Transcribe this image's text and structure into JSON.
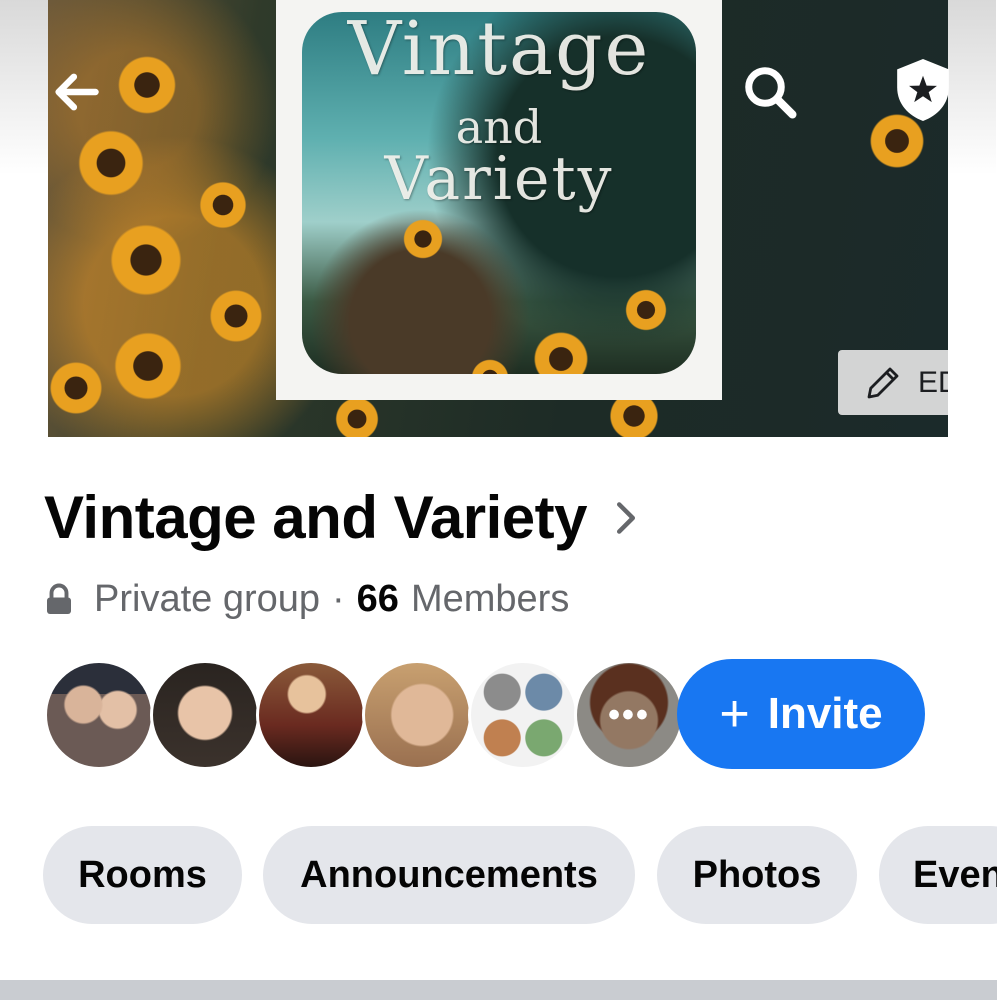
{
  "cover": {
    "title_line1": "Vintage",
    "title_line2": "and",
    "title_line3": "Variety",
    "edit_label": "EDIT"
  },
  "group": {
    "name": "Vintage and Variety",
    "privacy": "Private group",
    "member_count": "66",
    "members_label": "Members"
  },
  "members": {
    "avatar_count": 6,
    "more_indicator": "•••"
  },
  "invite": {
    "plus": "+",
    "label": "Invite"
  },
  "tabs": [
    {
      "label": "Rooms"
    },
    {
      "label": "Announcements"
    },
    {
      "label": "Photos"
    },
    {
      "label": "Even"
    }
  ],
  "colors": {
    "accent": "#1877f2",
    "chip_bg": "#e4e6eb",
    "secondary_text": "#65676b",
    "primary_text": "#050505"
  },
  "icons": [
    "back-arrow-icon",
    "search-icon",
    "admin-shield-star-icon",
    "pencil-icon",
    "chevron-right-icon",
    "lock-icon"
  ]
}
